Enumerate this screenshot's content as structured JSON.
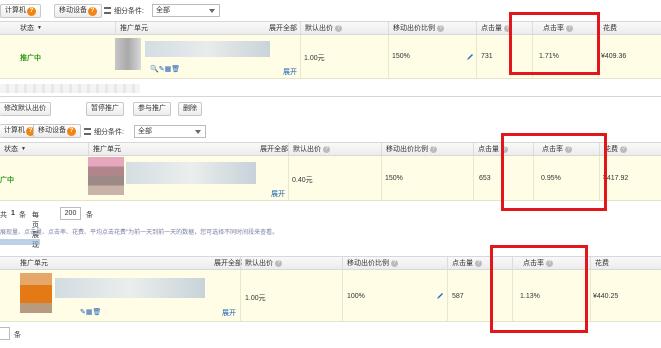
{
  "colors": {
    "red_box": "#e1171c",
    "row_highlight": "#fffde6",
    "status_green": "#2b9a1b",
    "badge_orange": "#f0850f",
    "link_blue": "#1a5fb4"
  },
  "block1": {
    "tabs": [
      {
        "label": "计算机",
        "badge": "?"
      },
      {
        "label": "移动设备",
        "badge": "?"
      }
    ],
    "filter_label": "细分条件:",
    "filter_value": "全部",
    "headers": {
      "status": "状态",
      "unit": "推广单元",
      "expand": "展开全部",
      "default_bid": "默认出价",
      "mobile_ratio": "移动出价比例",
      "clicks": "点击量",
      "ctr": "点击率",
      "cost": "花费"
    },
    "row": {
      "status": "推广中",
      "bid": "1.00元",
      "ratio": "150%",
      "clicks": "731",
      "ctr": "1.71%",
      "cost": "¥409.36",
      "expand": "展开"
    },
    "buttons": [
      "修改默认出价",
      "暂停推广",
      "参与推广",
      "删除"
    ]
  },
  "block2": {
    "tabs": [
      {
        "label": "计算机",
        "badge": "?"
      },
      {
        "label": "移动设备",
        "badge": "?"
      }
    ],
    "filter_label": "细分条件:",
    "filter_value": "全部",
    "headers": {
      "status": "状态",
      "unit": "推广单元",
      "expand": "展开全部",
      "default_bid": "默认出价",
      "mobile_ratio": "移动出价比例",
      "clicks": "点击量",
      "ctr": "点击率",
      "cost": "花费"
    },
    "row": {
      "status": "推广中",
      "bid": "0.40元",
      "ratio": "150%",
      "clicks": "653",
      "ctr": "0.95%",
      "cost": "¥417.92",
      "expand": "展开"
    },
    "pagination": {
      "total_prefix": "共",
      "total_count": "1",
      "total_suffix": "条",
      "per_page_label": "每页展现",
      "per_page_value": "200",
      "per_page_suffix": "条"
    },
    "note": "展现量、点击量、点击率、花费、平均点击花费\"为前一天到前一天的数据，您可选择不同时间段来查看。"
  },
  "block3": {
    "headers": {
      "unit": "推广单元",
      "expand": "展开全部",
      "default_bid": "默认出价",
      "mobile_ratio": "移动出价比例",
      "clicks": "点击量",
      "ctr": "点击率",
      "cost": "花费"
    },
    "row": {
      "bid": "1.00元",
      "ratio": "100%",
      "clicks": "587",
      "ctr": "1.13%",
      "cost": "¥440.25",
      "expand": "展开"
    },
    "footer_suffix": "条"
  }
}
